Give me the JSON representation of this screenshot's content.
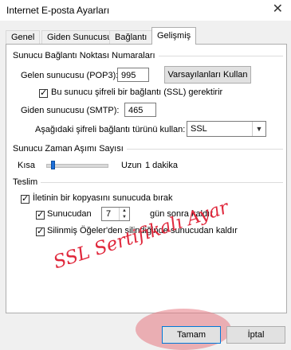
{
  "window": {
    "title": "Internet E-posta Ayarları",
    "close_icon": "close-icon"
  },
  "tabs": [
    {
      "label": "Genel"
    },
    {
      "label": "Giden Sunucusu"
    },
    {
      "label": "Bağlantı"
    },
    {
      "label": "Gelişmiş",
      "active": true
    }
  ],
  "server_ports": {
    "heading": "Sunucu Bağlantı Noktası Numaraları",
    "incoming_label": "Gelen sunucusu (POP3):",
    "incoming_value": "995",
    "defaults_button": "Varsayılanları Kullan",
    "ssl_checkbox_label": "Bu sunucu şifreli bir bağlantı (SSL) gerektirir",
    "ssl_checked": true,
    "outgoing_label": "Giden sunucusu (SMTP):",
    "outgoing_value": "465",
    "encryption_label": "Aşağıdaki şifreli bağlantı türünü kullan:",
    "encryption_value": "SSL"
  },
  "timeout": {
    "heading": "Sunucu Zaman Aşımı Sayısı",
    "short_label": "Kısa",
    "long_label": "Uzun",
    "value_text": "1 dakika",
    "slider_fraction": 0.08
  },
  "delivery": {
    "heading": "Teslim",
    "leave_copy_label": "İletinin bir kopyasını sunucuda bırak",
    "leave_copy_checked": true,
    "remove_after_label": "Sunucudan",
    "remove_after_checked": true,
    "remove_after_days": "7",
    "remove_after_suffix": "gün sonra kaldır",
    "remove_deleted_label": "Silinmiş Öğeler'den silindiğinde sunucudan kaldır",
    "remove_deleted_checked": true
  },
  "watermark": "SSL Sertifikalı Ayar",
  "footer": {
    "ok_label": "Tamam",
    "cancel_label": "İptal"
  },
  "colors": {
    "highlight": "#e67882",
    "watermark": "#e0283c",
    "accent": "#1e6fd9"
  }
}
